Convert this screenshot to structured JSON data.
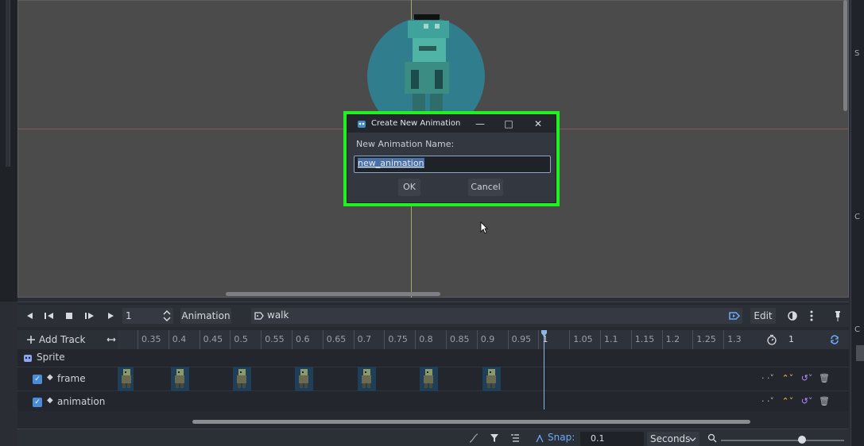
{
  "dialog": {
    "title": "Create New Animation",
    "label": "New Animation Name:",
    "input_value": "new_animation",
    "ok_label": "OK",
    "cancel_label": "Cancel",
    "minimize_glyph": "—",
    "maximize_glyph": "□",
    "close_glyph": "✕"
  },
  "toolbar": {
    "frame_value": "1",
    "animation_label": "Animation",
    "animation_name": "walk",
    "edit_label": "Edit"
  },
  "timeline": {
    "add_track_label": "Add Track",
    "ruler_ticks": [
      "0.35",
      "0.4",
      "0.45",
      "0.5",
      "0.55",
      "0.6",
      "0.65",
      "0.7",
      "0.75",
      "0.8",
      "0.85",
      "0.9",
      "0.95",
      "1",
      "1.05",
      "1.1",
      "1.15",
      "1.2",
      "1.25",
      "1.3"
    ],
    "length_value": "1",
    "tracks": {
      "node_label": "Sprite",
      "frame_label": "frame",
      "animation_label": "animation"
    }
  },
  "bottom_bar": {
    "snap_label": "Snap:",
    "snap_value": "0.1",
    "unit_label": "Seconds"
  },
  "colors": {
    "highlight": "#1ff31f",
    "accent": "#4a8cd8"
  }
}
